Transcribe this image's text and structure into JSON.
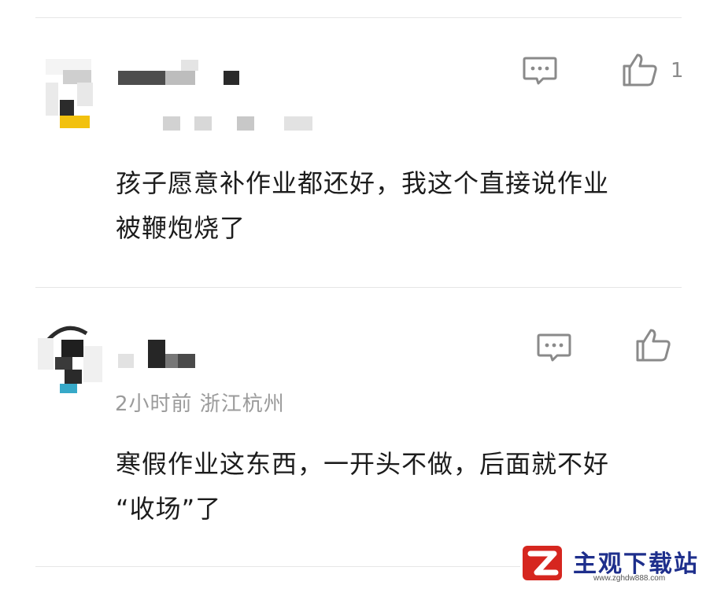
{
  "comments": [
    {
      "name": "",
      "meta": "",
      "text_lines": [
        "孩子愿意补作业都还好，我这个直接说作业",
        "被鞭炮烧了"
      ],
      "like_count": "1"
    },
    {
      "name": "",
      "meta": "2小时前  浙江杭州",
      "text_lines": [
        "寒假作业这东西，一开头不做，后面就不好",
        "“收场”了"
      ],
      "like_count": ""
    }
  ],
  "icons": {
    "reply": "comment-bubble-icon",
    "like": "thumbs-up-icon"
  },
  "watermark": {
    "title": "主观下载站",
    "url": "www.zghdw888.com"
  },
  "colors": {
    "text": "#1c1c1c",
    "meta": "#9b9b9b",
    "icon": "#8a8a8a",
    "divider": "#e6e6e6",
    "watermark_title": "#1e2f8c",
    "watermark_logo": "#d6261f"
  }
}
